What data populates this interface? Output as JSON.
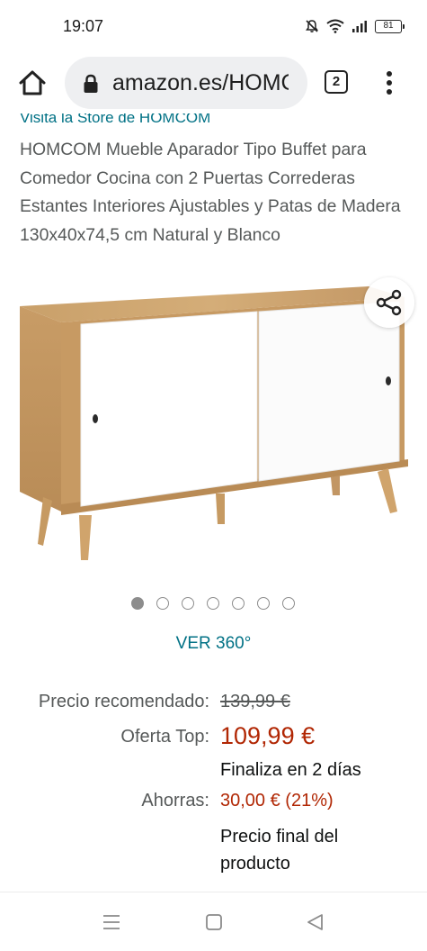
{
  "status_bar": {
    "time": "19:07",
    "battery": "81",
    "icons": [
      "mute-bell-icon",
      "wifi-icon",
      "signal-icon",
      "battery-icon"
    ]
  },
  "browser": {
    "url": "amazon.es/HOMCOM",
    "tab_count": "2",
    "icons": [
      "home-icon",
      "lock-icon",
      "overflow-menu-icon"
    ]
  },
  "product": {
    "store_link": "Visita la Store de HOMCOM",
    "title": "HOMCOM Mueble Aparador Tipo Buffet para Comedor Cocina con 2 Puertas Correderas Estantes Interiores Ajustables y Patas de Madera 130x40x74,5 cm Natural y Blanco",
    "image_count": 7,
    "active_image": 1,
    "view_360": "VER 360°"
  },
  "pricing": {
    "recommended_label": "Precio recomendado:",
    "recommended_value": "139,99 €",
    "offer_label": "Oferta Top:",
    "offer_value": "109,99 €",
    "ends": "Finaliza en 2 días",
    "savings_label": "Ahorras:",
    "savings_value": "30,00 € (21%)",
    "final_note": "Precio final del producto"
  },
  "colors": {
    "link": "#007185",
    "price": "#b12704",
    "muted_text": "#565959"
  },
  "nav_bar": {
    "icons": [
      "menu-icon",
      "home-square-icon",
      "back-triangle-icon"
    ]
  }
}
